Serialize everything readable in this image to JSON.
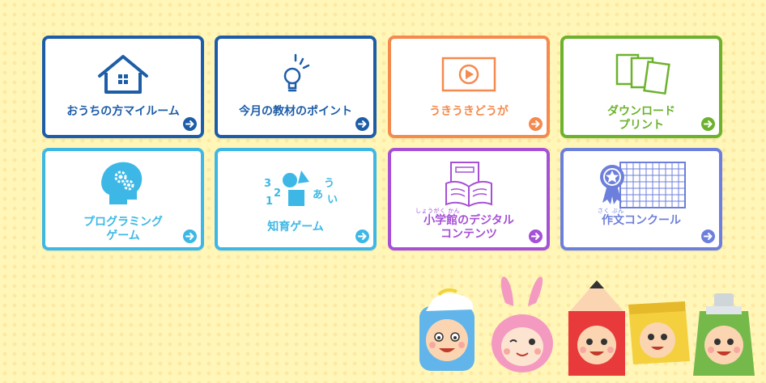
{
  "colors": {
    "background": "#fff6b8",
    "navy": "#1d5da8",
    "orange": "#f58a4f",
    "green": "#6cb22d",
    "sky": "#3db8e6",
    "purple": "#a550d6",
    "periwinkle": "#6d7fdc"
  },
  "cards": [
    {
      "label": "おうちの方マイルーム",
      "icon": "house-icon"
    },
    {
      "label": "今月の教材のポイント",
      "icon": "lightbulb-icon"
    },
    {
      "label": "うきうきどうが",
      "icon": "video-play-icon"
    },
    {
      "label_line1": "ダウンロード",
      "label_line2": "プリント",
      "icon": "printouts-icon"
    },
    {
      "label_line1": "プログラミング",
      "label_line2": "ゲーム",
      "icon": "head-gears-icon"
    },
    {
      "label": "知育ゲーム",
      "icon": "shapes-numbers-icon",
      "icon_text": {
        "n3": "3",
        "n2": "2",
        "n1": "1",
        "a": "あ",
        "u": "う",
        "i": "い"
      }
    },
    {
      "ruby": "しょうがく かん",
      "label_line1": "小学館のデジタル",
      "label_line2": "コンテンツ",
      "icon": "open-book-icon"
    },
    {
      "ruby": "さく ぶん",
      "label": "作文コンクール",
      "icon": "manuscript-medal-icon"
    }
  ],
  "mascots": [
    "blue-cap-mascot",
    "pink-bunny-mascot",
    "red-pencil-mascot",
    "yellow-paper-mascot",
    "green-paint-tube-mascot"
  ]
}
